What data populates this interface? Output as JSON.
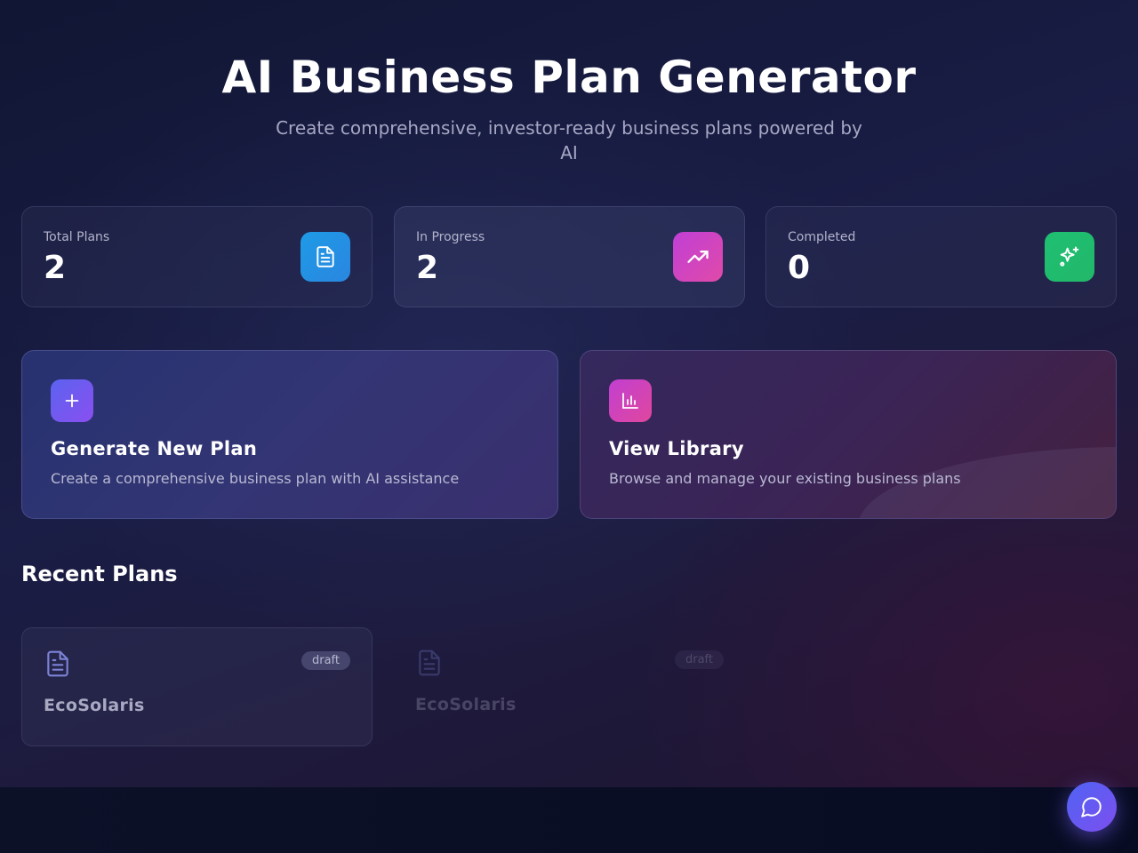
{
  "header": {
    "title": "AI Business Plan Generator",
    "subtitle": "Create comprehensive, investor-ready business plans powered by AI"
  },
  "stats": [
    {
      "label": "Total Plans",
      "value": "2",
      "icon": "document-icon",
      "color": "#1e9be6"
    },
    {
      "label": "In Progress",
      "value": "2",
      "icon": "trending-up-icon",
      "color": "#c03fd6"
    },
    {
      "label": "Completed",
      "value": "0",
      "icon": "sparkles-icon",
      "color": "#1fbf72"
    }
  ],
  "actions": [
    {
      "title": "Generate New Plan",
      "description": "Create a comprehensive business plan with AI assistance",
      "icon": "plus-icon"
    },
    {
      "title": "View Library",
      "description": "Browse and manage your existing business plans",
      "icon": "bar-chart-icon"
    }
  ],
  "recent": {
    "title": "Recent Plans",
    "plans": [
      {
        "name": "EcoSolaris",
        "status": "draft",
        "icon": "document-icon"
      },
      {
        "name": "EcoSolaris",
        "status": "draft",
        "icon": "document-icon"
      }
    ]
  },
  "chat": {
    "icon": "chat-bubble-icon"
  }
}
